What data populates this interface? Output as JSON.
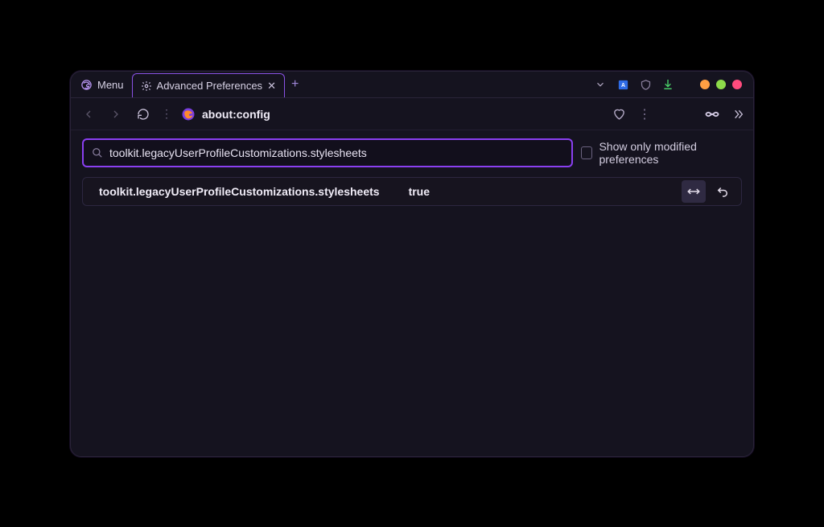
{
  "tabs": {
    "menu_label": "Menu",
    "active_label": "Advanced Preferences"
  },
  "url": "about:config",
  "search": {
    "value": "toolkit.legacyUserProfileCustomizations.stylesheets"
  },
  "filter_label": "Show only modified preferences",
  "result": {
    "name": "toolkit.legacyUserProfileCustomizations.stylesheets",
    "value": "true"
  }
}
